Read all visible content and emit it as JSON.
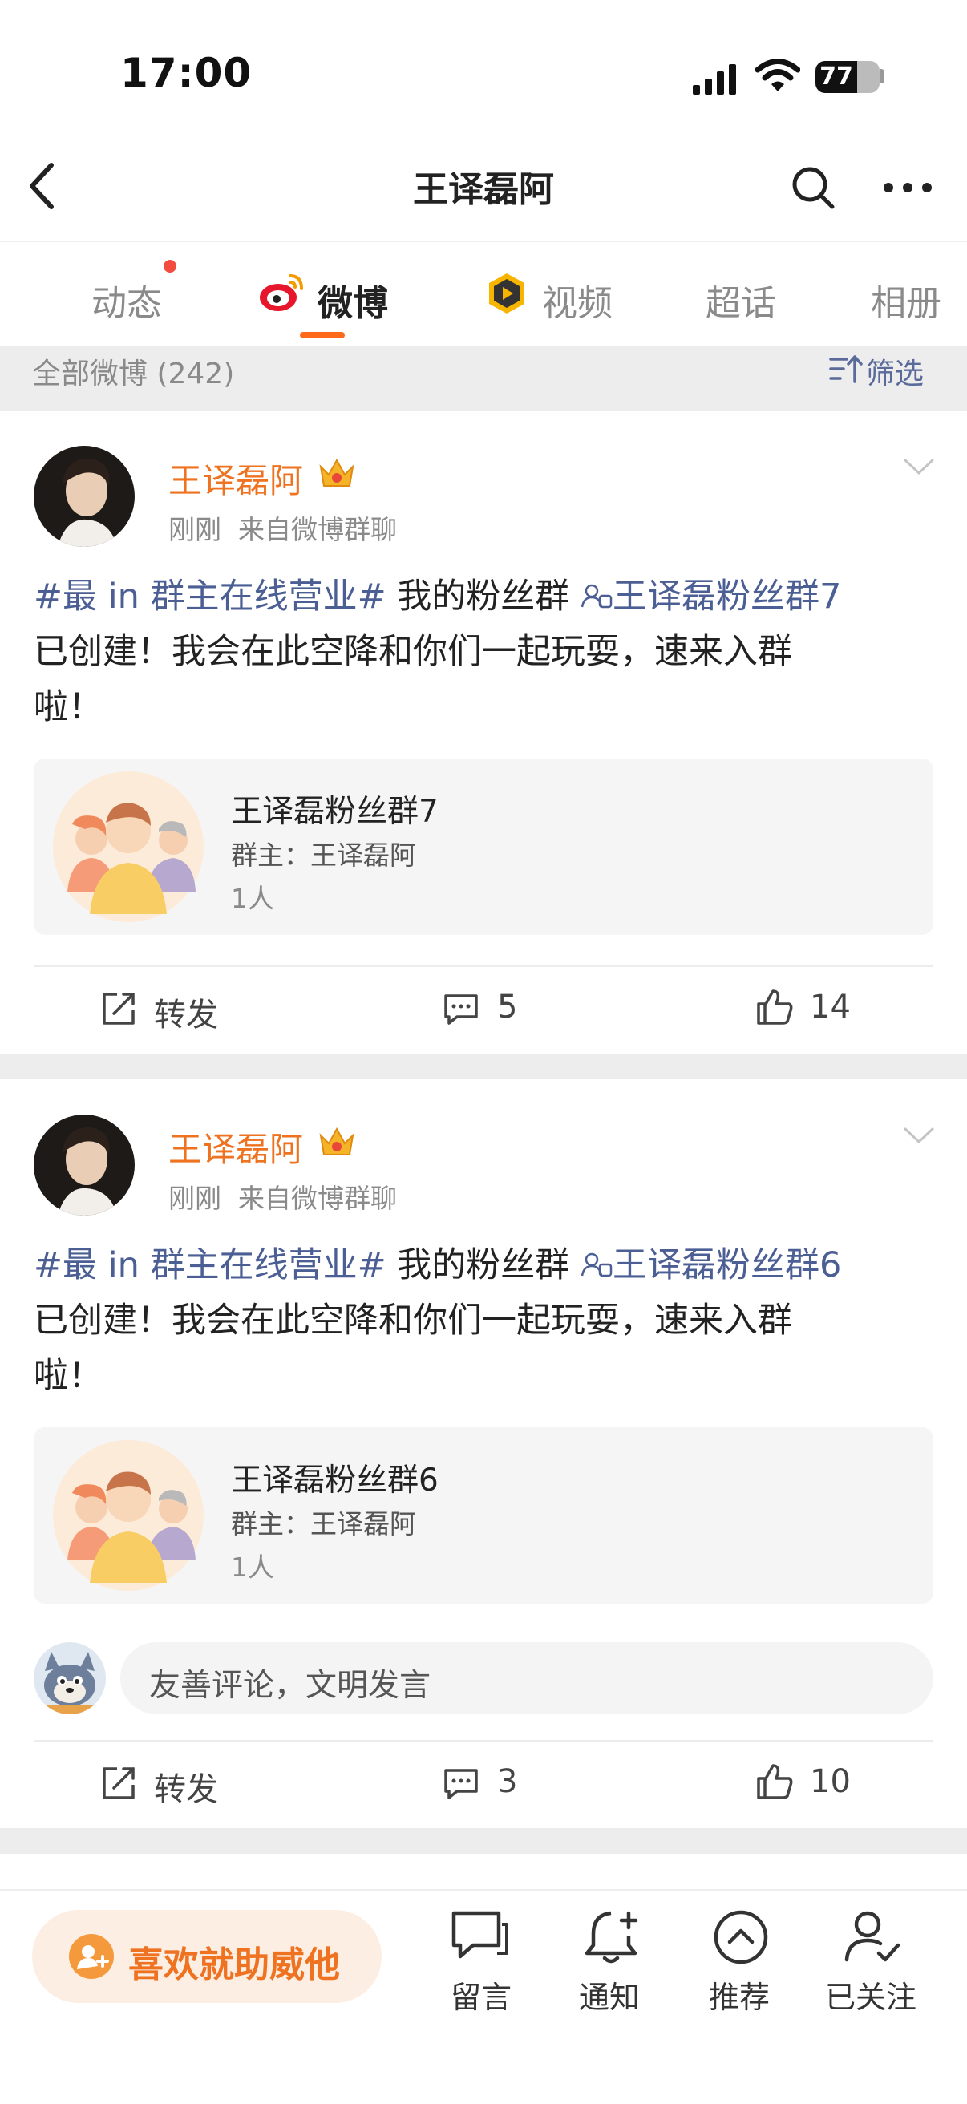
{
  "status": {
    "time": "17:00",
    "battery": "77"
  },
  "header": {
    "title": "王译磊阿"
  },
  "tabs": [
    {
      "label": "动态",
      "has_dot": true
    },
    {
      "label": "微博",
      "active": true
    },
    {
      "label": "视频"
    },
    {
      "label": "超话"
    },
    {
      "label": "相册"
    }
  ],
  "filter": {
    "summary": "全部微博 (242)",
    "filter_label": "筛选"
  },
  "posts": [
    {
      "author": "王译磊阿",
      "time": "刚刚",
      "source": "来自微博群聊",
      "topic": "#最 in 群主在线营业#",
      "text_a": " 我的粉丝群 ",
      "group_link": "王译磊粉丝群7",
      "text_line2": "已创建！我会在此空降和你们一起玩耍，速来入群",
      "text_line3": "啦！",
      "card": {
        "title": "王译磊粉丝群7",
        "owner": "群主：王译磊阿",
        "members": "1人"
      },
      "actions": {
        "repost": "转发",
        "comments": "5",
        "likes": "14"
      }
    },
    {
      "author": "王译磊阿",
      "time": "刚刚",
      "source": "来自微博群聊",
      "topic": "#最 in 群主在线营业#",
      "text_a": " 我的粉丝群 ",
      "group_link": "王译磊粉丝群6",
      "text_line2": "已创建！我会在此空降和你们一起玩耍，速来入群",
      "text_line3": "啦！",
      "card": {
        "title": "王译磊粉丝群6",
        "owner": "群主：王译磊阿",
        "members": "1人"
      },
      "comment_placeholder": "友善评论，文明发言",
      "actions": {
        "repost": "转发",
        "comments": "3",
        "likes": "10"
      }
    }
  ],
  "bottom_bar": {
    "support": "喜欢就助威他",
    "items": [
      {
        "label": "留言",
        "icon": "message-icon"
      },
      {
        "label": "通知",
        "icon": "bell-plus-icon"
      },
      {
        "label": "推荐",
        "icon": "chevron-up-circle-icon"
      },
      {
        "label": "已关注",
        "icon": "user-check-icon"
      }
    ]
  },
  "colors": {
    "accent": "#ee7220",
    "link": "#4c5f95",
    "tab_underline": "#ff6a1a"
  }
}
